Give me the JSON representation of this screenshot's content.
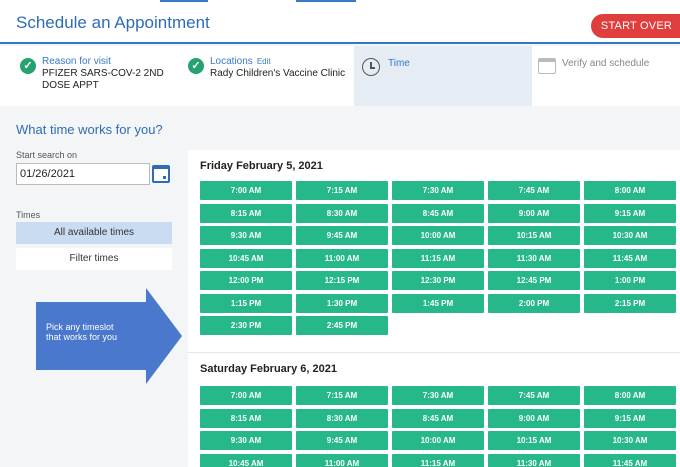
{
  "header": {
    "title": "Schedule an Appointment",
    "start_over": "START OVER"
  },
  "steps": {
    "reason": {
      "label": "Reason for visit",
      "value_line1": "PFIZER SARS-COV-2 2ND",
      "value_line2": "DOSE APPT"
    },
    "locations": {
      "label": "Locations",
      "edit": "Edit",
      "value": "Rady Children's Vaccine Clinic"
    },
    "time": {
      "label": "Time"
    },
    "verify": {
      "label": "Verify and schedule"
    }
  },
  "question": "What time works for you?",
  "search": {
    "label": "Start search on",
    "date": "01/26/2021"
  },
  "times": {
    "label": "Times",
    "all": "All available times",
    "filter": "Filter times"
  },
  "callout": "Pick any timeslot that works for you",
  "days": [
    {
      "title": "Friday February 5, 2021",
      "slots": [
        "7:00 AM",
        "7:15 AM",
        "7:30 AM",
        "7:45 AM",
        "8:00 AM",
        "8:15 AM",
        "8:30 AM",
        "8:45 AM",
        "9:00 AM",
        "9:15 AM",
        "9:30 AM",
        "9:45 AM",
        "10:00 AM",
        "10:15 AM",
        "10:30 AM",
        "10:45 AM",
        "11:00 AM",
        "11:15 AM",
        "11:30 AM",
        "11:45 AM",
        "12:00 PM",
        "12:15 PM",
        "12:30 PM",
        "12:45 PM",
        "1:00 PM",
        "1:15 PM",
        "1:30 PM",
        "1:45 PM",
        "2:00 PM",
        "2:15 PM",
        "2:30 PM",
        "2:45 PM"
      ]
    },
    {
      "title": "Saturday February 6, 2021",
      "slots": [
        "7:00 AM",
        "7:15 AM",
        "7:30 AM",
        "7:45 AM",
        "8:00 AM",
        "8:15 AM",
        "8:30 AM",
        "8:45 AM",
        "9:00 AM",
        "9:15 AM",
        "9:30 AM",
        "9:45 AM",
        "10:00 AM",
        "10:15 AM",
        "10:30 AM",
        "10:45 AM",
        "11:00 AM",
        "11:15 AM",
        "11:30 AM",
        "11:45 AM"
      ]
    }
  ],
  "colors": {
    "accent": "#2e6cb5",
    "slot": "#26b88b",
    "start_over": "#e03d3d",
    "check": "#25a26f",
    "arrow": "#4a78cc"
  }
}
